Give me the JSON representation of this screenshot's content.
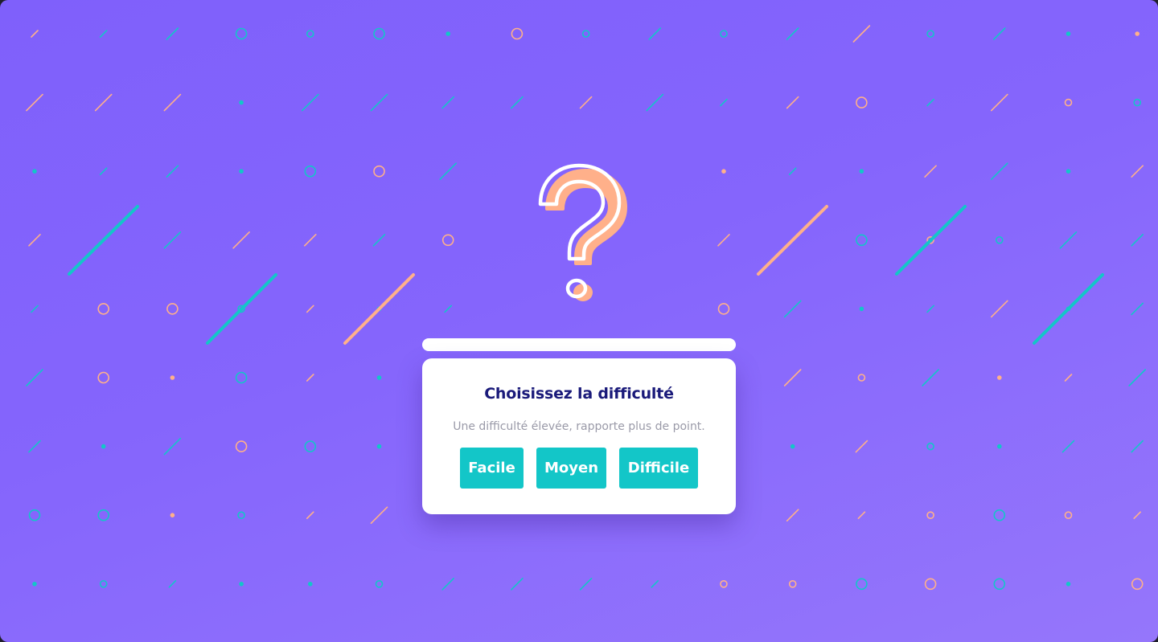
{
  "modal": {
    "title": "Choisissez la difficulté",
    "subtitle": "Une difficulté élevée, rapporte plus de point.",
    "buttons": {
      "easy": "Facile",
      "medium": "Moyen",
      "hard": "Difficile"
    }
  },
  "theme": {
    "background_start": "#7f60fb",
    "background_end": "#9576fb",
    "accent_teal": "#13c6c8",
    "accent_peach": "#ffb08a",
    "title_color": "#1a1a7a",
    "subtitle_color": "#9a9aa8"
  },
  "icons": {
    "hero": "question-mark-icon",
    "background": "confetti-pattern"
  }
}
